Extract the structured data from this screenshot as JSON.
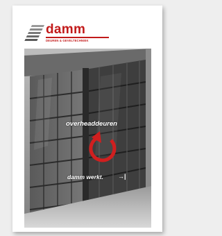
{
  "brochure": {
    "brand": "damm",
    "tagline": "DEUREN & GEVELTECHNIEK",
    "title": "overheaddeuren",
    "slogan": "damm werkt.",
    "slogan_arrow": "→|"
  },
  "icons": {
    "logo_mark": "striped-panel-logo-icon",
    "circular_arrow": "circular-arrow-icon"
  },
  "colors": {
    "brand_red": "#c21a1a",
    "logo_gray": "#8a8a8a"
  }
}
